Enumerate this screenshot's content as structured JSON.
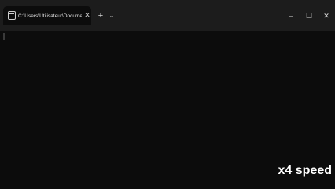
{
  "tab": {
    "title": "C:\\Users\\Utilisateur\\Documer",
    "icon": "terminal-icon",
    "close_glyph": "✕"
  },
  "toolbar": {
    "new_tab_glyph": "+",
    "dropdown_glyph": "⌄"
  },
  "window": {
    "minimize_glyph": "–",
    "maximize_glyph": "☐",
    "close_glyph": "✕"
  },
  "overlay": {
    "speed_label": "x4 speed"
  },
  "colors": {
    "terminal_bg": "#0c0c0c",
    "titlebar_bg": "#1c1c1c"
  }
}
